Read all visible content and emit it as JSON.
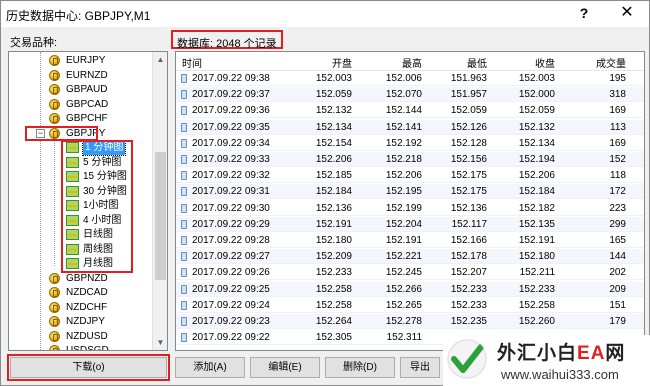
{
  "window": {
    "title": "历史数据中心: GBPJPY,M1",
    "help_label": "?",
    "close_label": "✕"
  },
  "labels": {
    "symbols": "交易品种:",
    "database": "数据库: 2048 个记录"
  },
  "tree": {
    "symbols_top": [
      "EURJPY",
      "EURNZD",
      "GBPAUD",
      "GBPCAD",
      "GBPCHF"
    ],
    "expanded_symbol": "GBPJPY",
    "expander_label": "−",
    "periods": [
      "1 分钟图",
      "5 分钟图",
      "15 分钟图",
      "30 分钟图",
      "1小时图",
      "4 小时图",
      "日线图",
      "周线图",
      "月线图"
    ],
    "selected_period_index": 0,
    "symbols_bottom": [
      "GBPNZD",
      "NZDCAD",
      "NZDCHF",
      "NZDJPY",
      "NZDUSD",
      "USDSGD"
    ]
  },
  "table": {
    "columns": [
      "时间",
      "开盘",
      "最高",
      "最低",
      "收盘",
      "成交量"
    ],
    "rows": [
      [
        "2017.09.22 09:38",
        "152.003",
        "152.006",
        "151.963",
        "152.003",
        "195"
      ],
      [
        "2017.09.22 09:37",
        "152.059",
        "152.070",
        "151.957",
        "152.000",
        "318"
      ],
      [
        "2017.09.22 09:36",
        "152.132",
        "152.144",
        "152.059",
        "152.059",
        "169"
      ],
      [
        "2017.09.22 09:35",
        "152.134",
        "152.141",
        "152.126",
        "152.132",
        "113"
      ],
      [
        "2017.09.22 09:34",
        "152.154",
        "152.192",
        "152.128",
        "152.134",
        "169"
      ],
      [
        "2017.09.22 09:33",
        "152.206",
        "152.218",
        "152.156",
        "152.194",
        "152"
      ],
      [
        "2017.09.22 09:32",
        "152.185",
        "152.206",
        "152.175",
        "152.206",
        "118"
      ],
      [
        "2017.09.22 09:31",
        "152.184",
        "152.195",
        "152.175",
        "152.184",
        "172"
      ],
      [
        "2017.09.22 09:30",
        "152.136",
        "152.199",
        "152.136",
        "152.182",
        "223"
      ],
      [
        "2017.09.22 09:29",
        "152.191",
        "152.204",
        "152.117",
        "152.135",
        "299"
      ],
      [
        "2017.09.22 09:28",
        "152.180",
        "152.191",
        "152.166",
        "152.191",
        "165"
      ],
      [
        "2017.09.22 09:27",
        "152.209",
        "152.221",
        "152.178",
        "152.180",
        "144"
      ],
      [
        "2017.09.22 09:26",
        "152.233",
        "152.245",
        "152.207",
        "152.211",
        "202"
      ],
      [
        "2017.09.22 09:25",
        "152.258",
        "152.266",
        "152.233",
        "152.233",
        "209"
      ],
      [
        "2017.09.22 09:24",
        "152.258",
        "152.265",
        "152.233",
        "152.258",
        "151"
      ],
      [
        "2017.09.22 09:23",
        "152.264",
        "152.278",
        "152.235",
        "152.260",
        "179"
      ],
      [
        "2017.09.22 09:22",
        "152.305",
        "152.311",
        "",
        "",
        ""
      ]
    ]
  },
  "buttons": {
    "download": "下载(o)",
    "add": "添加(A)",
    "edit": "编辑(E)",
    "delete": "删除(D)",
    "export": "导出"
  },
  "watermark": {
    "name_prefix": "外汇小白",
    "name_ea": "EA",
    "name_suffix": "网",
    "url": "www.waihui333.com"
  },
  "colors": {
    "highlight_red": "#e02020",
    "selection_blue": "#3399ff"
  }
}
